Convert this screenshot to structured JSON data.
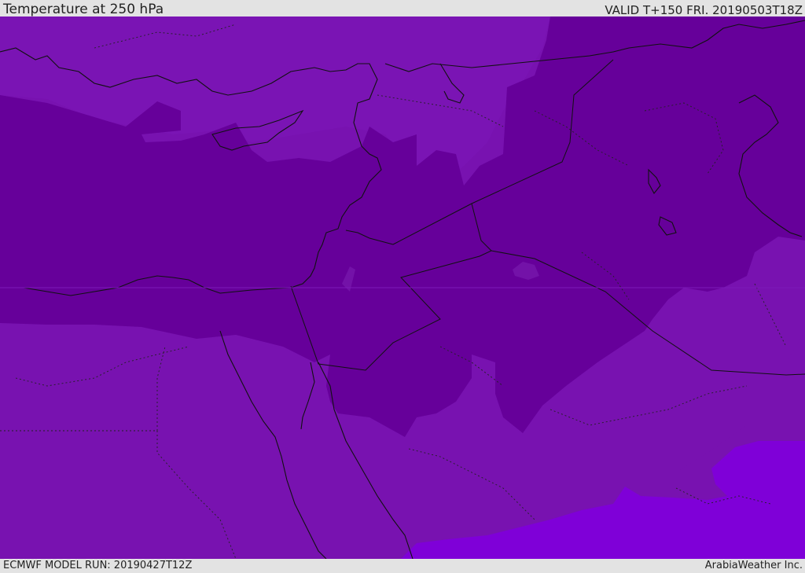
{
  "header": {
    "title": "Temperature at 250 hPa",
    "valid_time": "VALID T+150 FRI. 20190503T18Z"
  },
  "footer": {
    "model_run": "ECMWF MODEL RUN: 20190427T12Z",
    "credit": "ArabiaWeather Inc."
  },
  "map": {
    "field": "temperature",
    "level": "250 hPa",
    "colors": {
      "background": "#7810b0",
      "cold_core": "#66009a",
      "cold_mid": "#7312a8",
      "warm_band": "#7f00d8",
      "coastline": "#111111",
      "borders": "#1a1a1a"
    }
  }
}
